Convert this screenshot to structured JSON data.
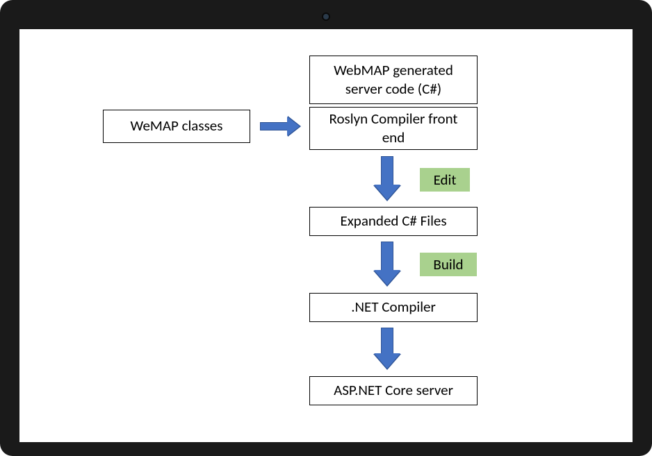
{
  "diagram": {
    "nodes": {
      "wemap_classes": "WeMAP classes",
      "webmap_generated": "WebMAP generated server code (C#)",
      "roslyn": "Roslyn Compiler front end",
      "expanded": "Expanded C# Files",
      "net_compiler": ".NET Compiler",
      "asp_net": "ASP.NET Core server"
    },
    "badges": {
      "edit": "Edit",
      "build": "Build"
    }
  }
}
